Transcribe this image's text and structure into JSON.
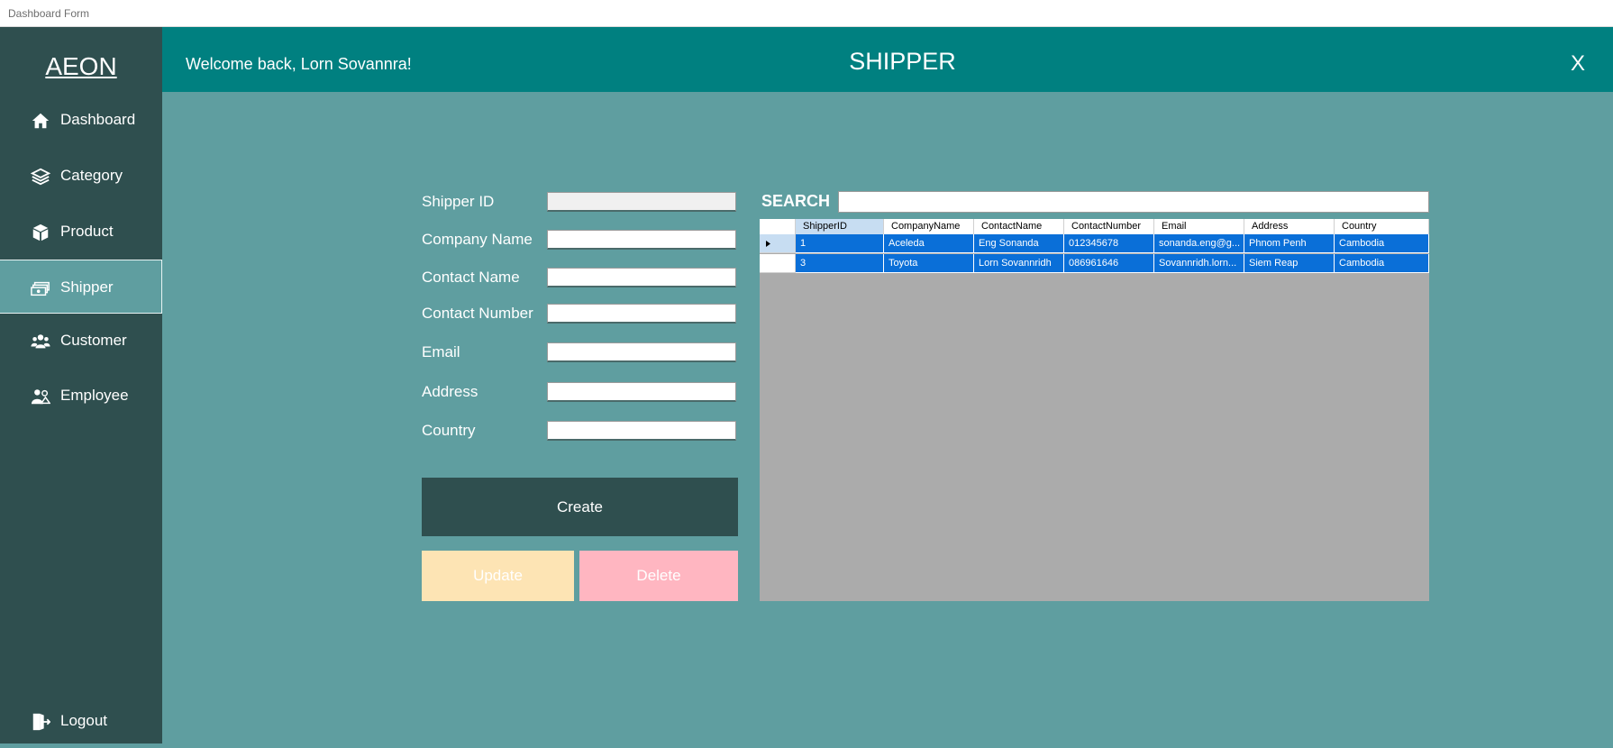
{
  "window": {
    "title": "Dashboard Form"
  },
  "sidebar": {
    "brand": "AEON",
    "items": [
      {
        "label": "Dashboard",
        "icon": "home-icon"
      },
      {
        "label": "Category",
        "icon": "layers-icon"
      },
      {
        "label": "Product",
        "icon": "box-icon"
      },
      {
        "label": "Shipper",
        "icon": "money-stack-icon",
        "active": true
      },
      {
        "label": "Customer",
        "icon": "users-icon"
      },
      {
        "label": "Employee",
        "icon": "employee-icon"
      }
    ],
    "logout": {
      "label": "Logout",
      "icon": "logout-icon"
    }
  },
  "header": {
    "welcome": "Welcome back, Lorn Sovannra!",
    "title": "SHIPPER",
    "close": "X"
  },
  "form": {
    "fields": [
      {
        "label": "Shipper ID",
        "value": "",
        "readonly": true
      },
      {
        "label": "Company Name",
        "value": ""
      },
      {
        "label": "Contact Name",
        "value": ""
      },
      {
        "label": "Contact Number",
        "value": ""
      },
      {
        "label": "Email",
        "value": ""
      },
      {
        "label": "Address",
        "value": ""
      },
      {
        "label": "Country",
        "value": ""
      }
    ],
    "create_label": "Create",
    "update_label": "Update",
    "delete_label": "Delete"
  },
  "search": {
    "label": "SEARCH",
    "value": ""
  },
  "grid": {
    "columns": [
      "ShipperID",
      "CompanyName",
      "ContactName",
      "ContactNumber",
      "Email",
      "Address",
      "Country"
    ],
    "rows": [
      [
        "1",
        "Aceleda",
        "Eng Sonanda",
        "012345678",
        "sonanda.eng@g...",
        "Phnom Penh",
        "Cambodia"
      ],
      [
        "3",
        "Toyota",
        "Lorn Sovannridh",
        "086961646",
        "Sovannridh.lorn...",
        "Siem Reap",
        "Cambodia"
      ]
    ]
  },
  "colors": {
    "sidebar": "#2f4f4f",
    "header": "#008080",
    "content": "#5f9ea0",
    "create_button": "#2f4f4f",
    "update_button": "#fde4b4",
    "delete_button": "#ffb6c1",
    "selected_row": "#0a6fd8",
    "grid_background": "#ababab"
  }
}
